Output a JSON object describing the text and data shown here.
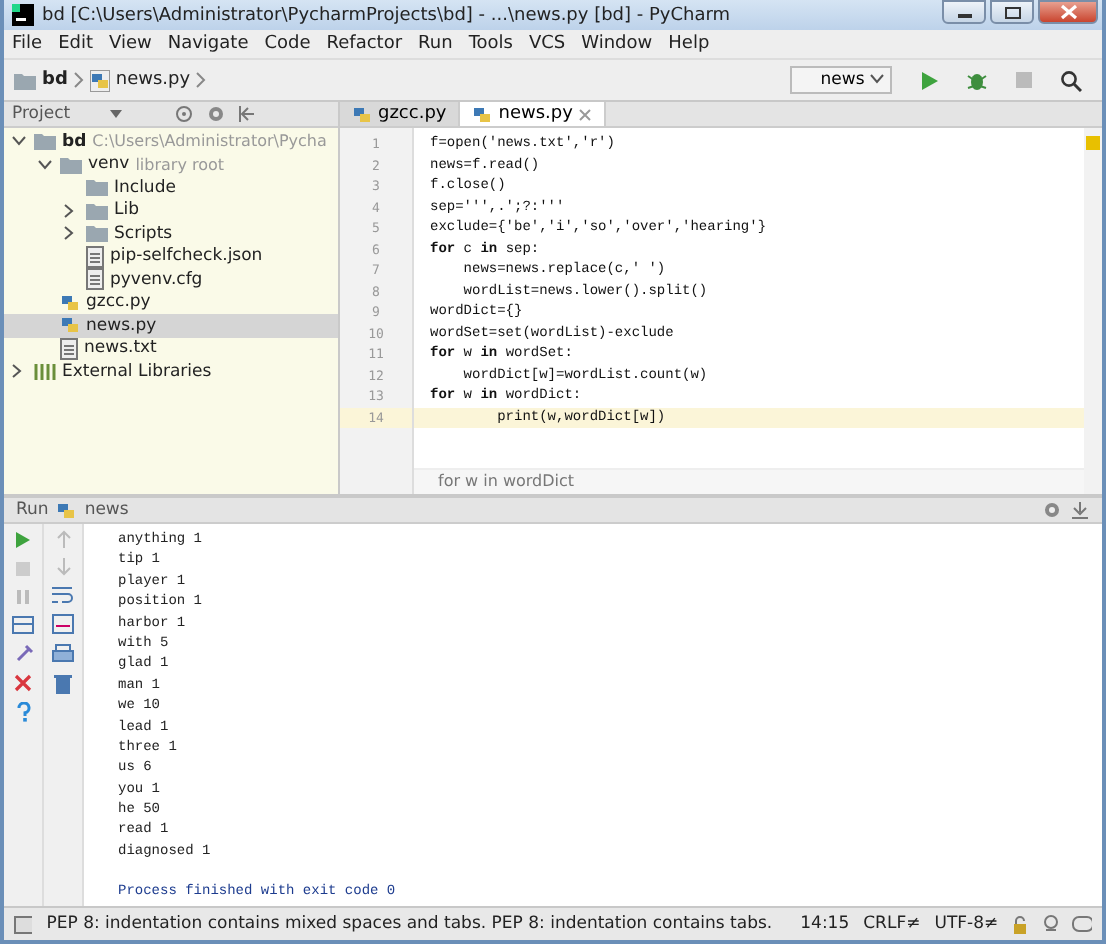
{
  "window": {
    "title": "bd [C:\\Users\\Administrator\\PycharmProjects\\bd] - ...\\news.py [bd] - PyCharm"
  },
  "menu": [
    "File",
    "Edit",
    "View",
    "Navigate",
    "Code",
    "Refactor",
    "Run",
    "Tools",
    "VCS",
    "Window",
    "Help"
  ],
  "navigation": {
    "breadcrumbs": [
      {
        "label": "bd",
        "kind": "folder"
      },
      {
        "label": "news.py",
        "kind": "python"
      }
    ],
    "run_config": "news"
  },
  "project_panel": {
    "title": "Project",
    "tree": [
      {
        "label": "bd",
        "hint": "C:\\Users\\Administrator\\Pycha",
        "kind": "folder",
        "expanded": true,
        "selected": false,
        "children": [
          {
            "label": "venv",
            "hint": "library root",
            "kind": "folder",
            "expanded": true,
            "selected": false,
            "children": [
              {
                "label": "Include",
                "kind": "folder",
                "expanded": false,
                "selected": false
              },
              {
                "label": "Lib",
                "kind": "folder",
                "expanded": false,
                "selected": false,
                "expandable": true
              },
              {
                "label": "Scripts",
                "kind": "folder",
                "expanded": false,
                "selected": false,
                "expandable": true
              },
              {
                "label": "pip-selfcheck.json",
                "kind": "file",
                "expanded": false,
                "selected": false
              },
              {
                "label": "pyvenv.cfg",
                "kind": "file",
                "expanded": false,
                "selected": false
              }
            ]
          },
          {
            "label": "gzcc.py",
            "kind": "python",
            "expanded": false,
            "selected": false
          },
          {
            "label": "news.py",
            "kind": "python",
            "expanded": false,
            "selected": true
          },
          {
            "label": "news.txt",
            "kind": "file",
            "expanded": false,
            "selected": false
          }
        ]
      },
      {
        "label": "External Libraries",
        "kind": "library",
        "expanded": false,
        "selected": false,
        "expandable": true
      }
    ]
  },
  "editor": {
    "tabs": [
      {
        "label": "gzcc.py",
        "selected": false
      },
      {
        "label": "news.py",
        "selected": true
      }
    ],
    "lines": [
      {
        "number": "1",
        "code": "f=open('news.txt','r')",
        "current": false
      },
      {
        "number": "2",
        "code": "news=f.read()",
        "current": false
      },
      {
        "number": "3",
        "code": "f.close()",
        "current": false
      },
      {
        "number": "4",
        "code": "sep=''',.';?:'''",
        "current": false
      },
      {
        "number": "5",
        "code": "exclude={'be','i','so','over','hearing'}",
        "current": false
      },
      {
        "number": "6",
        "code": "**for** c **in** sep:",
        "current": false
      },
      {
        "number": "7",
        "code": "    news=news.replace(c,' ')",
        "current": false
      },
      {
        "number": "8",
        "code": "    wordList=news.lower().split()",
        "current": false
      },
      {
        "number": "9",
        "code": "wordDict={}",
        "current": false
      },
      {
        "number": "10",
        "code": "wordSet=set(wordList)-exclude",
        "current": false
      },
      {
        "number": "11",
        "code": "**for** w **in** wordSet:",
        "current": false
      },
      {
        "number": "12",
        "code": "    wordDict[w]=wordList.count(w)",
        "current": false
      },
      {
        "number": "13",
        "code": "**for** w **in** wordDict:",
        "current": false
      },
      {
        "number": "14",
        "code": "        print(w,wordDict[w])",
        "current": true
      }
    ],
    "breadcrumb": "for w in wordDict"
  },
  "run_panel": {
    "title": "Run",
    "config": "news",
    "output": [
      "anything 1",
      "tip 1",
      "player 1",
      "position 1",
      "harbor 1",
      "with 5",
      "glad 1",
      "man 1",
      "we 10",
      "lead 1",
      "three 1",
      "us 6",
      "you 1",
      "he 50",
      "read 1",
      "diagnosed 1"
    ],
    "exit_message": "Process finished with exit code 0"
  },
  "status_bar": {
    "message": "PEP 8: indentation contains mixed spaces and tabs. PEP 8: indentation contains tabs.",
    "position": "14:15",
    "line_separator": "CRLF≠",
    "encoding": "UTF-8≠"
  }
}
